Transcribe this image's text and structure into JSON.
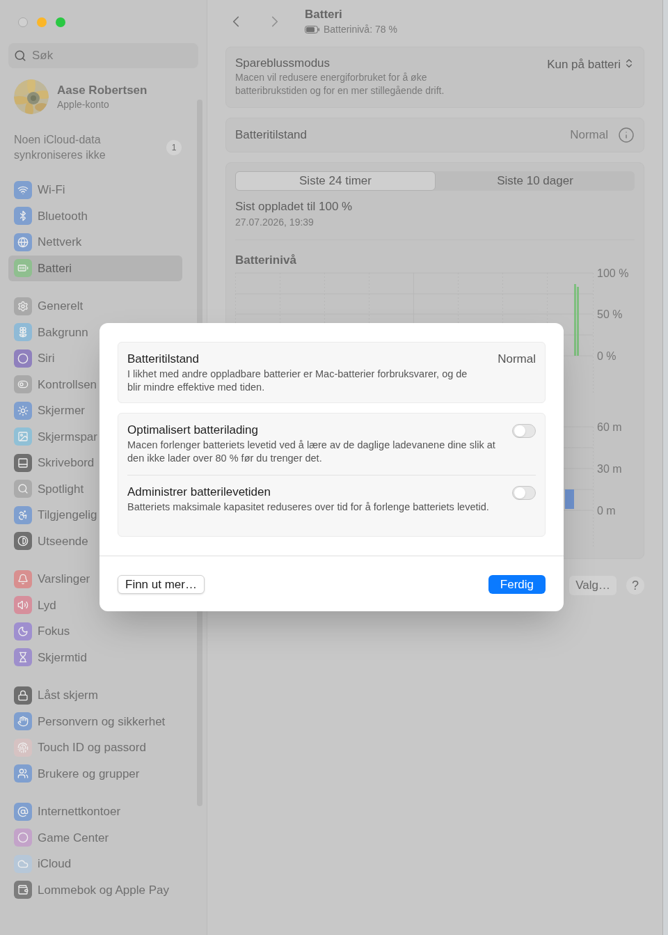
{
  "window": {
    "controls": [
      {
        "kind": "close",
        "color": "#d0d0d0"
      },
      {
        "kind": "minimize",
        "color": "#fbb628"
      },
      {
        "kind": "zoom",
        "color": "#2ac843"
      }
    ]
  },
  "sidebar": {
    "search": {
      "placeholder": "Søk"
    },
    "account": {
      "name": "Aase Robertsen",
      "subtitle": "Apple-konto"
    },
    "notice": {
      "text": "Noen iCloud-data synkroniseres ikke",
      "badge": "1"
    },
    "groups": [
      {
        "items": [
          {
            "label": "Wi-Fi",
            "color": "#7f9fcf",
            "selected": false
          },
          {
            "label": "Bluetooth",
            "color": "#7f9fcf",
            "selected": false
          },
          {
            "label": "Nettverk",
            "color": "#7f9fcf",
            "selected": false
          },
          {
            "label": "Batteri",
            "color": "#8fbf8f",
            "selected": true
          }
        ]
      },
      {
        "items": [
          {
            "label": "Generelt",
            "color": "#a9a9a9",
            "selected": false
          },
          {
            "label": "Bakgrunn",
            "color": "#8fbad6",
            "selected": false
          },
          {
            "label": "Siri",
            "color": "#8f80bd",
            "selected": false
          },
          {
            "label": "Kontrollsen",
            "color": "#a9a9a9",
            "selected": false
          },
          {
            "label": "Skjermer",
            "color": "#7f9fcf",
            "selected": false
          },
          {
            "label": "Skjermspar",
            "color": "#90c0d6",
            "selected": false
          },
          {
            "label": "Skrivebord",
            "color": "#6f6f6f",
            "selected": false
          },
          {
            "label": "Spotlight",
            "color": "#ababab",
            "selected": false
          },
          {
            "label": "Tilgjengelig",
            "color": "#7f9fcf",
            "selected": false
          },
          {
            "label": "Utseende",
            "color": "#707070",
            "selected": false
          }
        ]
      },
      {
        "items": [
          {
            "label": "Varslinger",
            "color": "#d88f8f",
            "selected": false
          },
          {
            "label": "Lyd",
            "color": "#d68f9c",
            "selected": false
          },
          {
            "label": "Fokus",
            "color": "#9f8fcf",
            "selected": false
          },
          {
            "label": "Skjermtid",
            "color": "#9e8fcc",
            "selected": false
          }
        ]
      },
      {
        "items": [
          {
            "label": "Låst skjerm",
            "color": "#6e6e6e",
            "selected": false
          },
          {
            "label": "Personvern og sikkerhet",
            "color": "#7f9fcf",
            "selected": false
          },
          {
            "label": "Touch ID og passord",
            "color": "#d6c2c2",
            "selected": false
          },
          {
            "label": "Brukere og grupper",
            "color": "#7f9fcf",
            "selected": false
          }
        ]
      },
      {
        "items": [
          {
            "label": "Internettkontoer",
            "color": "#7f9fcf",
            "selected": false
          },
          {
            "label": "Game Center",
            "color": "#c3a3c9",
            "selected": false
          },
          {
            "label": "iCloud",
            "color": "#b6c7d8",
            "selected": false
          },
          {
            "label": "Lommebok og Apple Pay",
            "color": "#7d7d7d",
            "selected": false
          }
        ]
      }
    ]
  },
  "header": {
    "title": "Batteri",
    "subtitle": "Batterinivå: 78 %"
  },
  "low_power": {
    "title": "Spareblussmodus",
    "description": "Macen vil redusere energiforbruket for å øke batteribrukstiden og for en mer stillegående drift.",
    "value": "Kun på batteri"
  },
  "health": {
    "title": "Batteritilstand",
    "value": "Normal"
  },
  "history": {
    "tabs": [
      {
        "label": "Siste 24 timer",
        "selected": true
      },
      {
        "label": "Siste 10 dager",
        "selected": false
      }
    ],
    "last_charged": {
      "title": "Sist oppladet til 100 %",
      "time": "27.07.2026, 19:39"
    },
    "battery_chart": {
      "title": "Batterinivå",
      "y_labels": [
        "100 %",
        "50 %",
        "0 %"
      ]
    },
    "usage_chart": {
      "y_labels": [
        "60 m",
        "30 m",
        "0 m"
      ]
    }
  },
  "footer_buttons": [
    {
      "label": "Valg…",
      "kind": "text"
    },
    {
      "label": "?",
      "kind": "help"
    }
  ],
  "dialog": {
    "status": {
      "title": "Batteritilstand",
      "value": "Normal",
      "description": "I likhet med andre oppladbare batterier er Mac-batterier forbruksvarer, og de blir mindre effektive med tiden."
    },
    "options": [
      {
        "title": "Optimalisert batterilading",
        "description": "Macen forlenger batteriets levetid ved å lære av de daglige ladevanene dine slik at den ikke lader over 80 % før du trenger det.",
        "on": false
      },
      {
        "title": "Administrer batterilevetiden",
        "description": "Batteriets maksimale kapasitet reduseres over tid for å forlenge batteriets levetid.",
        "on": false
      }
    ],
    "buttons": [
      {
        "label": "Finn ut mer…",
        "kind": "secondary"
      },
      {
        "label": "Ferdig",
        "kind": "primary"
      }
    ]
  }
}
